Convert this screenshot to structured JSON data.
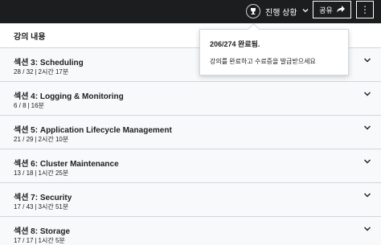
{
  "header": {
    "progress_label": "진행 상황",
    "share_label": "공유",
    "more_label": "⋮"
  },
  "panel": {
    "title": "강의 내용",
    "sections": [
      {
        "title": "섹션 3: Scheduling",
        "progress": "28 / 32",
        "duration": "2시간 17분"
      },
      {
        "title": "섹션 4: Logging & Monitoring",
        "progress": "6 / 8",
        "duration": "16분"
      },
      {
        "title": "섹션 5: Application Lifecycle Management",
        "progress": "21 / 29",
        "duration": "2시간 10분"
      },
      {
        "title": "섹션 6: Cluster Maintenance",
        "progress": "13 / 18",
        "duration": "1시간 25분"
      },
      {
        "title": "섹션 7: Security",
        "progress": "17 / 43",
        "duration": "3시간 51분"
      },
      {
        "title": "섹션 8: Storage",
        "progress": "17 / 17",
        "duration": "1시간 5분"
      }
    ]
  },
  "popover": {
    "title": "206/274 완료됨.",
    "description": "강의를 완료하고 수료증을 발급받으세요"
  }
}
